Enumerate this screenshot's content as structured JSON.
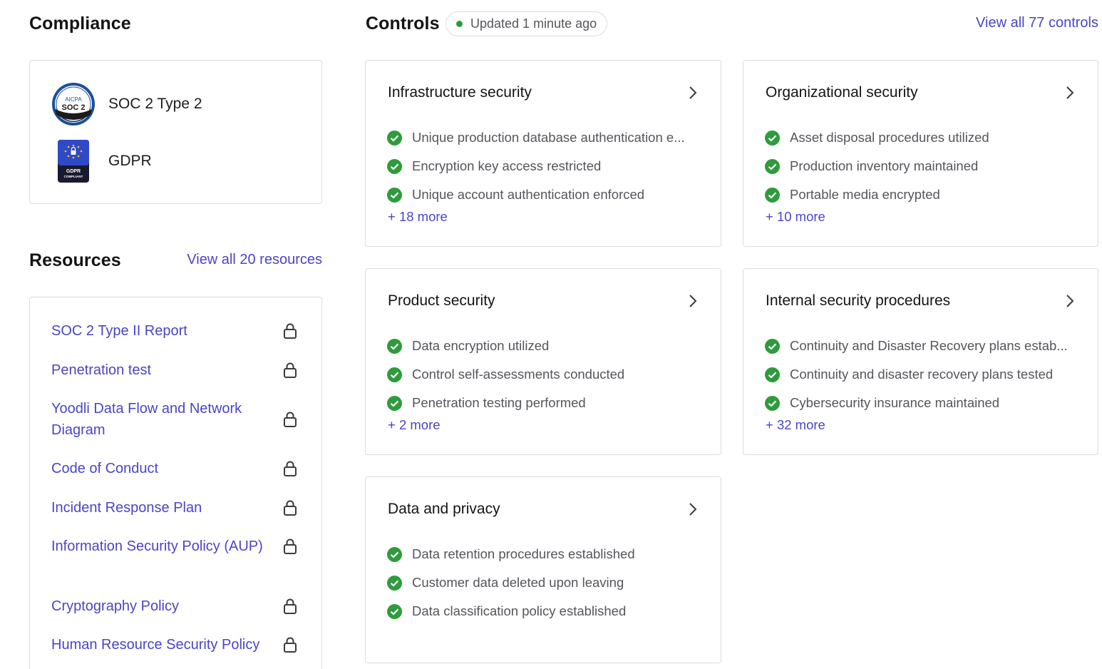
{
  "compliance": {
    "title": "Compliance",
    "certifications": [
      {
        "name": "SOC 2 Type 2",
        "logo_text_top": "AICPA",
        "logo_text_main": "SOC 2",
        "icon": "soc2-badge-icon"
      },
      {
        "name": "GDPR",
        "logo_text_main": "GDPR",
        "logo_text_sub": "COMPLIANT",
        "icon": "gdpr-badge-icon"
      }
    ]
  },
  "resources": {
    "title": "Resources",
    "view_all": "View all 20 resources",
    "items": [
      {
        "label": "SOC 2 Type II Report"
      },
      {
        "label": "Penetration test"
      },
      {
        "label": "Yoodli Data Flow and Network Diagram"
      },
      {
        "label": "Code of Conduct"
      },
      {
        "label": "Incident Response Plan"
      },
      {
        "label": "Information Security Policy (AUP)"
      },
      {
        "label": "Cryptography Policy"
      },
      {
        "label": "Human Resource Security Policy"
      }
    ]
  },
  "controls": {
    "title": "Controls",
    "updated": "Updated 1 minute ago",
    "view_all": "View all 77 controls",
    "status_color": "#2e9b3d",
    "accent_color": "#4a45c7",
    "cards": [
      {
        "title": "Infrastructure security",
        "items": [
          "Unique production database authentication e...",
          "Encryption key access restricted",
          "Unique account authentication enforced"
        ],
        "more": "+ 18 more"
      },
      {
        "title": "Organizational security",
        "items": [
          "Asset disposal procedures utilized",
          "Production inventory maintained",
          "Portable media encrypted"
        ],
        "more": "+ 10 more"
      },
      {
        "title": "Product security",
        "items": [
          "Data encryption utilized",
          "Control self-assessments conducted",
          "Penetration testing performed"
        ],
        "more": "+ 2 more"
      },
      {
        "title": "Internal security procedures",
        "items": [
          "Continuity and Disaster Recovery plans estab...",
          "Continuity and disaster recovery plans tested",
          "Cybersecurity insurance maintained"
        ],
        "more": "+ 32 more"
      },
      {
        "title": "Data and privacy",
        "items": [
          "Data retention procedures established",
          "Customer data deleted upon leaving",
          "Data classification policy established"
        ],
        "more": ""
      }
    ]
  }
}
